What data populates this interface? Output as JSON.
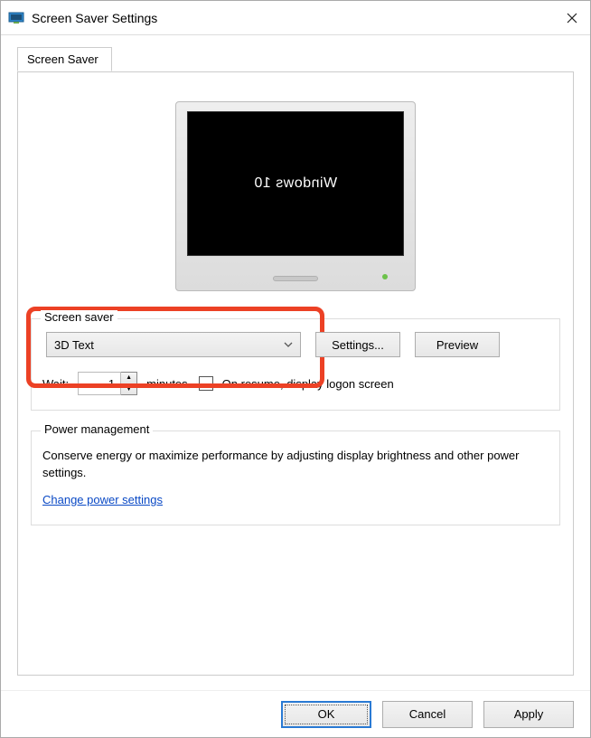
{
  "window": {
    "title": "Screen Saver Settings"
  },
  "tab": {
    "label": "Screen Saver"
  },
  "preview": {
    "screen_text": "Windows 10"
  },
  "screensaver_group": {
    "label": "Screen saver",
    "selected": "3D Text",
    "settings_btn": "Settings...",
    "preview_btn": "Preview"
  },
  "wait": {
    "label": "Wait:",
    "value": "1",
    "unit": "minutes",
    "resume_label": "On resume, display logon screen"
  },
  "power_group": {
    "label": "Power management",
    "desc": "Conserve energy or maximize performance by adjusting display brightness and other power settings.",
    "link": "Change power settings"
  },
  "footer": {
    "ok": "OK",
    "cancel": "Cancel",
    "apply": "Apply"
  }
}
